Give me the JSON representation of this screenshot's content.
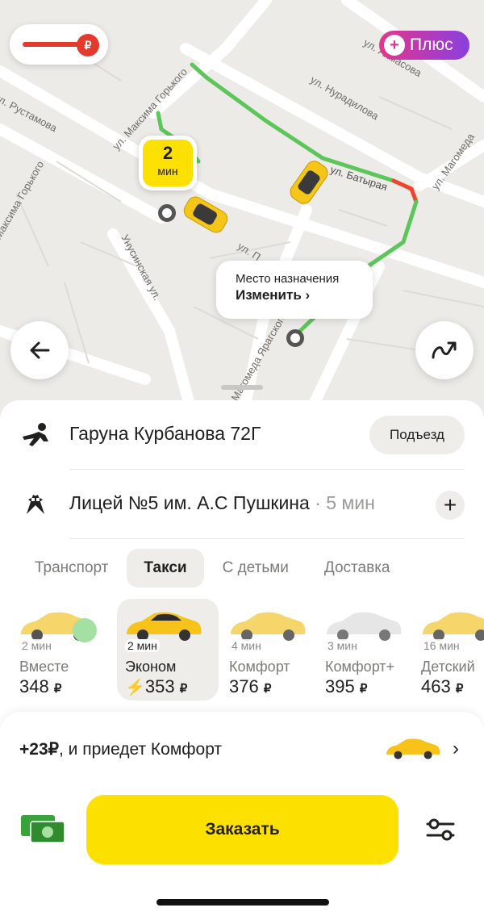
{
  "map": {
    "streets": [
      "ул. Рустамова",
      "ул. Максима Горького",
      "Максима Горького",
      "ул. Нурадилова",
      "ул. Ахмасова",
      "ул. Батырая",
      "ул. Магомеда",
      "Унусинская ул.",
      "ул. П",
      "Магомеда Ярагского"
    ],
    "eta": {
      "value": "2",
      "unit": "мин"
    },
    "destination": {
      "title": "Место назначения",
      "action": "Изменить"
    },
    "plus_label": "Плюс",
    "route_color": "#5dc65a"
  },
  "addresses": {
    "from": {
      "text": "Гаруна Курбанова 72Г",
      "button": "Подъезд"
    },
    "to": {
      "text": "Лицей №5 им. А.С Пушкина",
      "extra": "5 мин",
      "add_label": "+"
    }
  },
  "tabs": [
    {
      "label": "Транспорт",
      "active": false
    },
    {
      "label": "Такси",
      "active": true
    },
    {
      "label": "С детьми",
      "active": false
    },
    {
      "label": "Доставка",
      "active": false
    }
  ],
  "tariffs": [
    {
      "time": "2 мин",
      "name": "Вместе",
      "price": "348",
      "currency": "₽",
      "active": false,
      "surge": false
    },
    {
      "time": "2 мин",
      "name": "Эконом",
      "price": "353",
      "currency": "₽",
      "active": true,
      "surge": true
    },
    {
      "time": "4 мин",
      "name": "Комфорт",
      "price": "376",
      "currency": "₽",
      "active": false,
      "surge": false
    },
    {
      "time": "3 мин",
      "name": "Комфорт+",
      "price": "395",
      "currency": "₽",
      "active": false,
      "surge": false
    },
    {
      "time": "16 мин",
      "name": "Детский",
      "price": "463",
      "currency": "₽",
      "active": false,
      "surge": false
    }
  ],
  "upsell": {
    "price_part": "+23₽",
    "text_part": ", и приедет Комфорт"
  },
  "order_button": "Заказать",
  "colors": {
    "accent": "#fce000",
    "surge": "#f0432e",
    "plus_start": "#e4368c",
    "plus_end": "#8a3fe0"
  }
}
